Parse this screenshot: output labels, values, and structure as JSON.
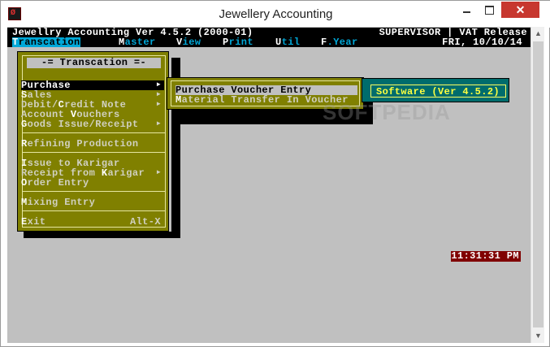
{
  "window": {
    "title": "Jewellery Accounting",
    "close_glyph": "✕"
  },
  "console": {
    "header_left": "Jewellry Accounting Ver 4.5.2 (2000-01)",
    "header_right": "SUPERVISOR | VAT Release",
    "menu_bar": [
      {
        "hotkey": "T",
        "rest": "ranscation",
        "active": true
      },
      {
        "hotkey": "M",
        "rest": "aster",
        "active": false
      },
      {
        "hotkey": "V",
        "rest": "iew",
        "active": false
      },
      {
        "hotkey": "P",
        "rest": "rint",
        "active": false
      },
      {
        "hotkey": "U",
        "rest": "til",
        "active": false
      },
      {
        "hotkey": "F",
        "rest": ".Year",
        "active": false
      }
    ],
    "date": "FRI, 10/10/14",
    "clock": "11:31:31 PM"
  },
  "dropdown": {
    "title": "-= Transcation =-",
    "items": [
      {
        "hotkey": "P",
        "rest": "urchase",
        "submenu": true,
        "selected": true
      },
      {
        "hotkey": "S",
        "rest": "ales",
        "submenu": true,
        "selected": false
      },
      {
        "prefix": "Debit/",
        "hotkey": "C",
        "rest": "redit Note",
        "submenu": true,
        "selected": false
      },
      {
        "prefix": "Account ",
        "hotkey": "V",
        "rest": "ouchers",
        "submenu": false,
        "selected": false
      },
      {
        "hotkey": "G",
        "rest": "oods Issue/Receipt",
        "submenu": true,
        "selected": false
      },
      {
        "hotkey": "R",
        "rest": "efining Production",
        "submenu": false,
        "selected": false
      },
      {
        "hotkey": "I",
        "rest": "ssue to Karigar",
        "submenu": false,
        "selected": false
      },
      {
        "prefix": "Receipt from ",
        "hotkey": "K",
        "rest": "arigar",
        "submenu": true,
        "selected": false
      },
      {
        "hotkey": "O",
        "rest": "rder Entry",
        "submenu": false,
        "selected": false
      },
      {
        "hotkey": "M",
        "rest": "ixing Entry",
        "submenu": false,
        "selected": false
      },
      {
        "hotkey": "E",
        "rest": "xit",
        "accelerator": "Alt-X",
        "submenu": false,
        "selected": false
      }
    ],
    "arrow_glyph": "►"
  },
  "submenu": {
    "items": [
      {
        "hotkey": "P",
        "rest": "urchase Voucher Entry",
        "selected": true
      },
      {
        "hotkey": "M",
        "rest": "aterial Transfer In Voucher",
        "selected": false
      }
    ]
  },
  "info_box": {
    "text": "Software (Ver 4.5.2)"
  },
  "watermark": "SOFTPEDIA",
  "colors": {
    "console_bg": "#c0c0c0",
    "menu_bg": "#808000",
    "menu_bar_accent": "#00a8d8",
    "info_box_bg": "#006c6c",
    "info_box_text": "#ffff40",
    "clock_bg": "#800000"
  }
}
